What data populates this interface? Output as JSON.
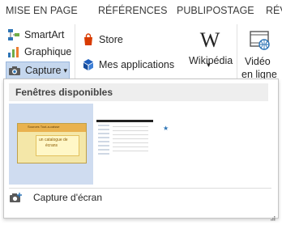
{
  "tabs": [
    "MISE EN PAGE",
    "RÉFÉRENCES",
    "PUBLIPOSTAGE",
    "RÉV"
  ],
  "illustrations": {
    "smartart_label": "SmartArt",
    "graphique_label": "Graphique",
    "capture_label": "Capture",
    "capture_arrow": "▾"
  },
  "addins": {
    "store_label": "Store",
    "mes_apps_label": "Mes applications",
    "mes_apps_arrow": "▾",
    "wikipedia_label": "Wikipédia",
    "wikipedia_logo": "W"
  },
  "media": {
    "video_line1": "Vidéo",
    "video_line2": "en ligne"
  },
  "capture_menu": {
    "header": "Fenêtres disponibles",
    "screen_capture_label": "Capture d'écran",
    "thumbnails": [
      {
        "name": "window-thumbnail-1",
        "title_line": "Sources Tout-a-caisse",
        "body_lines": [
          "un catalogue de",
          "écrans"
        ]
      },
      {
        "name": "window-thumbnail-2"
      }
    ]
  },
  "colors": {
    "selected_bg": "#cfdcf0",
    "capture_highlight": "#c5d7ee",
    "store_red": "#d83b01",
    "apps_blue": "#1e5ebc"
  }
}
